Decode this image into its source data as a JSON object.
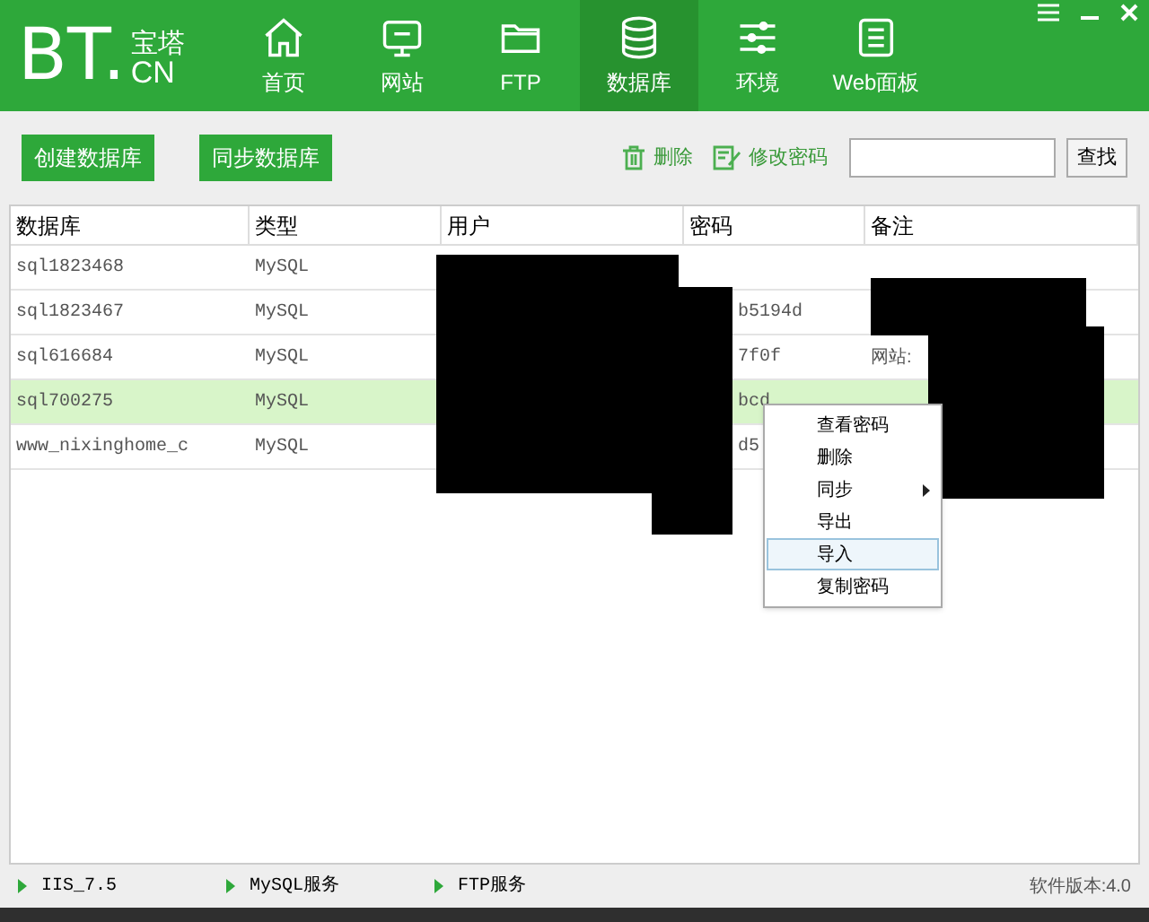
{
  "logo": {
    "mark": "BT.",
    "top": "宝塔",
    "bottom": "CN"
  },
  "nav": [
    {
      "label": "首页",
      "selected": false
    },
    {
      "label": "网站",
      "selected": false
    },
    {
      "label": "FTP",
      "selected": false
    },
    {
      "label": "数据库",
      "selected": true
    },
    {
      "label": "环境",
      "selected": false
    },
    {
      "label": "Web面板",
      "selected": false
    }
  ],
  "toolbar": {
    "buttons": [
      "创建数据库",
      "同步数据库"
    ],
    "actions": [
      "删除",
      "修改密码"
    ],
    "search_button": "查找"
  },
  "table": {
    "columns": [
      "数据库",
      "类型",
      "用户",
      "密码",
      "备注"
    ],
    "rows": [
      {
        "cells": [
          "sql1823468",
          "MySQL",
          "",
          "",
          ""
        ],
        "selected": false
      },
      {
        "cells": [
          "sql1823467",
          "MySQL",
          "",
          "b5194d",
          ""
        ],
        "selected": false
      },
      {
        "cells": [
          "sql616684",
          "MySQL",
          "",
          "7f0f",
          "网站:"
        ],
        "selected": false
      },
      {
        "cells": [
          "sql700275",
          "MySQL",
          "",
          "bcd",
          ""
        ],
        "selected": true
      },
      {
        "cells": [
          "www_nixinghome_c",
          "MySQL",
          "",
          "d5",
          ""
        ],
        "selected": false
      }
    ]
  },
  "context_menu": [
    {
      "label": "查看密码",
      "submenu": false,
      "selected": false
    },
    {
      "label": "删除",
      "submenu": false,
      "selected": false
    },
    {
      "label": "同步",
      "submenu": true,
      "selected": false
    },
    {
      "label": "导出",
      "submenu": false,
      "selected": false
    },
    {
      "label": "导入",
      "submenu": false,
      "selected": true
    },
    {
      "label": "复制密码",
      "submenu": false,
      "selected": false
    }
  ],
  "status_bar": {
    "services": [
      "IIS_7.5",
      "MySQL服务",
      "FTP服务"
    ],
    "version": "软件版本:4.0"
  }
}
